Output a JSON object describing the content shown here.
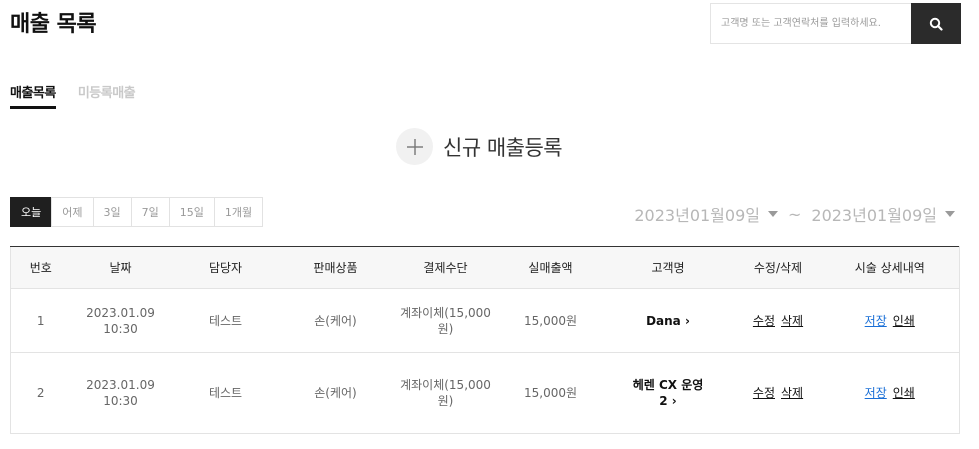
{
  "header": {
    "title": "매출 목록",
    "search_placeholder": "고객명 또는 고객연락처를 입력하세요."
  },
  "tabs": [
    {
      "label": "매출목록",
      "active": true
    },
    {
      "label": "미등록매출",
      "active": false
    }
  ],
  "new_sale": {
    "label": "신규 매출등록"
  },
  "period_buttons": [
    {
      "label": "오늘",
      "active": true
    },
    {
      "label": "어제"
    },
    {
      "label": "3일"
    },
    {
      "label": "7일"
    },
    {
      "label": "15일"
    },
    {
      "label": "1개월"
    }
  ],
  "date_range": {
    "start": "2023년01월09일",
    "separator": "~",
    "end": "2023년01월09일"
  },
  "table": {
    "headers": [
      "번호",
      "날짜",
      "담당자",
      "판매상품",
      "결제수단",
      "실매출액",
      "고객명",
      "수정/삭제",
      "시술 상세내역"
    ],
    "rows": [
      {
        "no": "1",
        "date": "2023.01.09",
        "time": "10:30",
        "staff": "테스트",
        "product": "손(케어)",
        "payment_1": "계좌이체(15,000",
        "payment_2": "원)",
        "amount": "15,000원",
        "customer_1": "Dana",
        "customer_2": "",
        "edit": "수정",
        "delete": "삭제",
        "save": "저장",
        "print": "인쇄"
      },
      {
        "no": "2",
        "date": "2023.01.09",
        "time": "10:30",
        "staff": "테스트",
        "product": "손(케어)",
        "payment_1": "계좌이체(15,000",
        "payment_2": "원)",
        "amount": "15,000원",
        "customer_1": "헤렌 CX 운영",
        "customer_2": "2",
        "edit": "수정",
        "delete": "삭제",
        "save": "저장",
        "print": "인쇄"
      }
    ]
  },
  "colors": {
    "accent_dark": "#1f1f1f",
    "link_blue": "#1a6fd6"
  },
  "icons": {
    "search": "search-icon",
    "plus": "plus-icon",
    "chevron": "chevron-right-icon",
    "caret": "caret-down-icon"
  }
}
